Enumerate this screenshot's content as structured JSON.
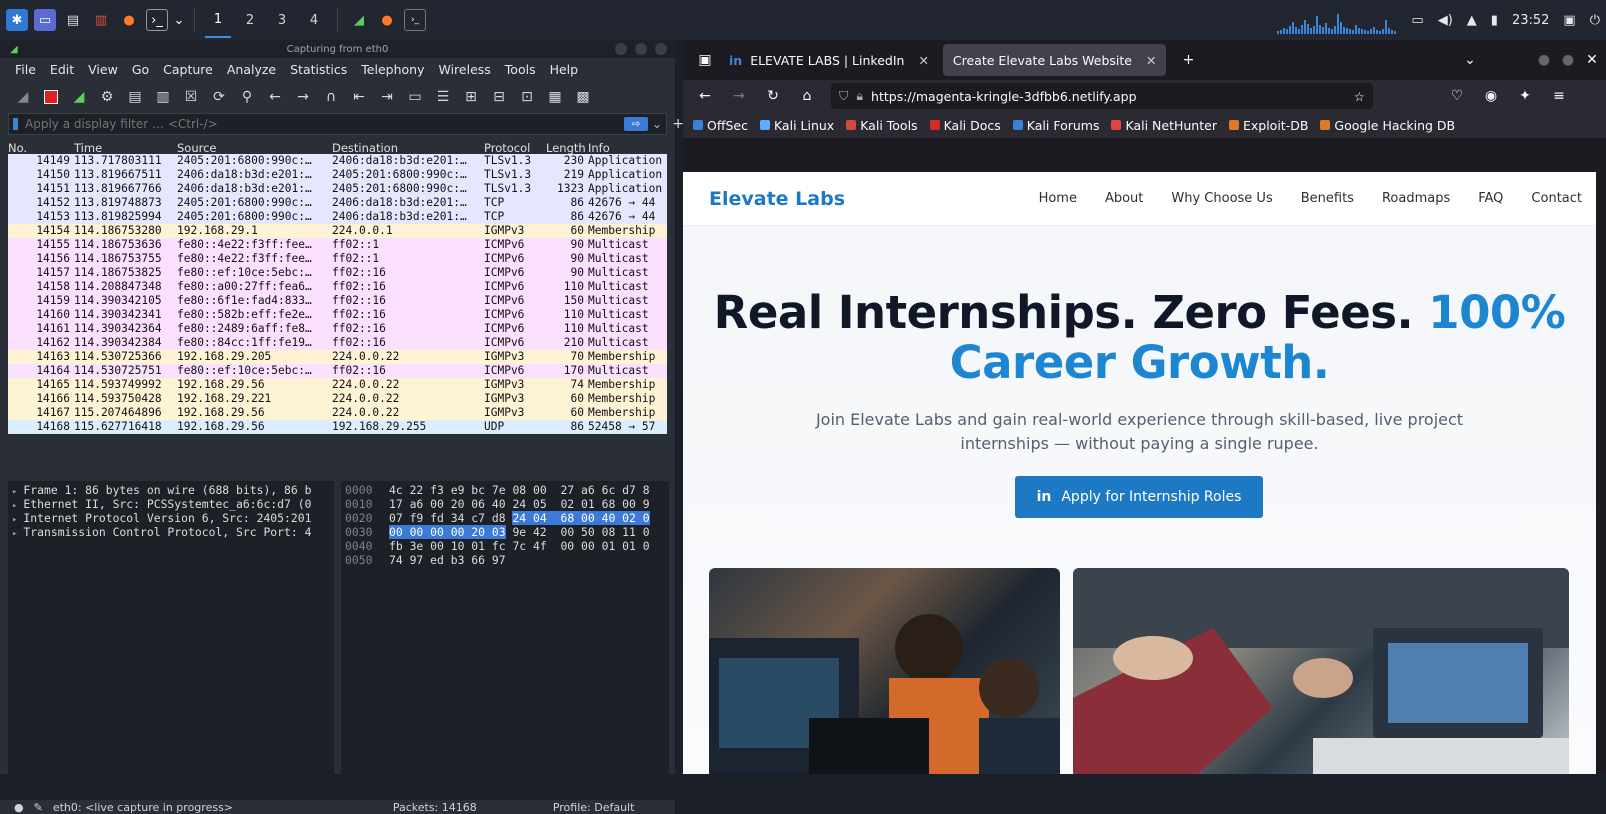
{
  "taskbar": {
    "workspaces": [
      "1",
      "2",
      "3",
      "4"
    ],
    "clock": "23:52"
  },
  "wireshark": {
    "title": "Capturing from eth0",
    "menu": [
      "File",
      "Edit",
      "View",
      "Go",
      "Capture",
      "Analyze",
      "Statistics",
      "Telephony",
      "Wireless",
      "Tools",
      "Help"
    ],
    "filter_placeholder": "Apply a display filter … <Ctrl-/>",
    "columns": [
      "No.",
      "Time",
      "Source",
      "Destination",
      "Protocol",
      "Length",
      "Info"
    ],
    "packets": [
      {
        "no": "14149",
        "time": "113.717803111",
        "src": "2405:201:6800:990c:…",
        "dst": "2406:da18:b3d:e201:…",
        "proto": "TLSv1.3",
        "len": "230",
        "info": "Application",
        "cls": "bg-tcp"
      },
      {
        "no": "14150",
        "time": "113.819667511",
        "src": "2406:da18:b3d:e201:…",
        "dst": "2405:201:6800:990c:…",
        "proto": "TLSv1.3",
        "len": "219",
        "info": "Application",
        "cls": "bg-tcp"
      },
      {
        "no": "14151",
        "time": "113.819667766",
        "src": "2406:da18:b3d:e201:…",
        "dst": "2405:201:6800:990c:…",
        "proto": "TLSv1.3",
        "len": "1323",
        "info": "Application",
        "cls": "bg-tcp"
      },
      {
        "no": "14152",
        "time": "113.819748873",
        "src": "2405:201:6800:990c:…",
        "dst": "2406:da18:b3d:e201:…",
        "proto": "TCP",
        "len": "86",
        "info": "42676 → 44",
        "cls": "bg-tcp"
      },
      {
        "no": "14153",
        "time": "113.819825994",
        "src": "2405:201:6800:990c:…",
        "dst": "2406:da18:b3d:e201:…",
        "proto": "TCP",
        "len": "86",
        "info": "42676 → 44",
        "cls": "bg-tcp"
      },
      {
        "no": "14154",
        "time": "114.186753280",
        "src": "192.168.29.1",
        "dst": "224.0.0.1",
        "proto": "IGMPv3",
        "len": "60",
        "info": "Membership",
        "cls": "bg-igmp"
      },
      {
        "no": "14155",
        "time": "114.186753636",
        "src": "fe80::4e22:f3ff:fee…",
        "dst": "ff02::1",
        "proto": "ICMPv6",
        "len": "90",
        "info": "Multicast",
        "cls": "bg-icmp"
      },
      {
        "no": "14156",
        "time": "114.186753755",
        "src": "fe80::4e22:f3ff:fee…",
        "dst": "ff02::1",
        "proto": "ICMPv6",
        "len": "90",
        "info": "Multicast",
        "cls": "bg-icmp"
      },
      {
        "no": "14157",
        "time": "114.186753825",
        "src": "fe80::ef:10ce:5ebc:…",
        "dst": "ff02::16",
        "proto": "ICMPv6",
        "len": "90",
        "info": "Multicast",
        "cls": "bg-icmp"
      },
      {
        "no": "14158",
        "time": "114.208847348",
        "src": "fe80::a00:27ff:fea6…",
        "dst": "ff02::16",
        "proto": "ICMPv6",
        "len": "110",
        "info": "Multicast",
        "cls": "bg-icmp"
      },
      {
        "no": "14159",
        "time": "114.390342105",
        "src": "fe80::6f1e:fad4:833…",
        "dst": "ff02::16",
        "proto": "ICMPv6",
        "len": "150",
        "info": "Multicast",
        "cls": "bg-icmp"
      },
      {
        "no": "14160",
        "time": "114.390342341",
        "src": "fe80::582b:eff:fe2e…",
        "dst": "ff02::16",
        "proto": "ICMPv6",
        "len": "110",
        "info": "Multicast",
        "cls": "bg-icmp"
      },
      {
        "no": "14161",
        "time": "114.390342364",
        "src": "fe80::2489:6aff:fe8…",
        "dst": "ff02::16",
        "proto": "ICMPv6",
        "len": "110",
        "info": "Multicast",
        "cls": "bg-icmp"
      },
      {
        "no": "14162",
        "time": "114.390342384",
        "src": "fe80::84cc:1ff:fe19…",
        "dst": "ff02::16",
        "proto": "ICMPv6",
        "len": "210",
        "info": "Multicast",
        "cls": "bg-icmp"
      },
      {
        "no": "14163",
        "time": "114.530725366",
        "src": "192.168.29.205",
        "dst": "224.0.0.22",
        "proto": "IGMPv3",
        "len": "70",
        "info": "Membership",
        "cls": "bg-igmp"
      },
      {
        "no": "14164",
        "time": "114.530725751",
        "src": "fe80::ef:10ce:5ebc:…",
        "dst": "ff02::16",
        "proto": "ICMPv6",
        "len": "170",
        "info": "Multicast",
        "cls": "bg-icmp"
      },
      {
        "no": "14165",
        "time": "114.593749992",
        "src": "192.168.29.56",
        "dst": "224.0.0.22",
        "proto": "IGMPv3",
        "len": "74",
        "info": "Membership",
        "cls": "bg-igmp"
      },
      {
        "no": "14166",
        "time": "114.593750428",
        "src": "192.168.29.221",
        "dst": "224.0.0.22",
        "proto": "IGMPv3",
        "len": "60",
        "info": "Membership",
        "cls": "bg-igmp"
      },
      {
        "no": "14167",
        "time": "115.207464896",
        "src": "192.168.29.56",
        "dst": "224.0.0.22",
        "proto": "IGMPv3",
        "len": "60",
        "info": "Membership",
        "cls": "bg-igmp"
      },
      {
        "no": "14168",
        "time": "115.627716418",
        "src": "192.168.29.56",
        "dst": "192.168.29.255",
        "proto": "UDP",
        "len": "86",
        "info": "52458 → 57",
        "cls": "bg-udp"
      }
    ],
    "details": [
      "Frame 1: 86 bytes on wire (688 bits), 86 b",
      "Ethernet II, Src: PCSSystemtec_a6:6c:d7 (0",
      "Internet Protocol Version 6, Src: 2405:201",
      "Transmission Control Protocol, Src Port: 4"
    ],
    "hex": [
      {
        "off": "0000",
        "a": "4c 22 f3 e9 bc 7e 08 00  27 a6 6c d7 8",
        "h": "",
        "b": ""
      },
      {
        "off": "0010",
        "a": "17 a6 00 20 06 40 24 05  02 01 68 00 9",
        "h": "",
        "b": ""
      },
      {
        "off": "0020",
        "a": "07 f9 fd 34 c7 d8 ",
        "h": "24 04  68 00 40 02 0",
        "b": ""
      },
      {
        "off": "0030",
        "a": "",
        "h": "00 00 00 00 20 03",
        "b": " 9e 42  00 50 08 11 0"
      },
      {
        "off": "0040",
        "a": "fb 3e 00 10 01 fc 7c 4f  00 00 01 01 0",
        "h": "",
        "b": ""
      },
      {
        "off": "0050",
        "a": "74 97 ed b3 66 97",
        "h": "",
        "b": ""
      }
    ],
    "status": {
      "iface": "eth0: <live capture in progress>",
      "packets": "Packets: 14168",
      "profile": "Profile: Default"
    }
  },
  "firefox": {
    "tabs": [
      {
        "label": "ELEVATE LABS | LinkedIn"
      },
      {
        "label": "Create Elevate Labs Website"
      }
    ],
    "url": "https://magenta-kringle-3dfbb6.netlify.app",
    "bookmarks": [
      {
        "label": "OffSec",
        "color": "#3c7fd6"
      },
      {
        "label": "Kali Linux",
        "color": "#5ab0ff"
      },
      {
        "label": "Kali Tools",
        "color": "#d24a3a"
      },
      {
        "label": "Kali Docs",
        "color": "#d42a2a"
      },
      {
        "label": "Kali Forums",
        "color": "#3c7fd6"
      },
      {
        "label": "Kali NetHunter",
        "color": "#e04444"
      },
      {
        "label": "Exploit-DB",
        "color": "#e0782a"
      },
      {
        "label": "Google Hacking DB",
        "color": "#e0782a"
      }
    ]
  },
  "site": {
    "logo": "Elevate Labs",
    "nav": [
      "Home",
      "About",
      "Why Choose Us",
      "Benefits",
      "Roadmaps",
      "FAQ",
      "Contact"
    ],
    "headline_dark": "Real Internships. Zero Fees. ",
    "headline_blue1": "100%",
    "headline_blue2": "Career Growth.",
    "subtitle": "Join Elevate Labs and gain real-world experience through skill-based, live project internships — without paying a single rupee.",
    "cta": "Apply for Internship Roles",
    "accent": "#1d79c4"
  }
}
